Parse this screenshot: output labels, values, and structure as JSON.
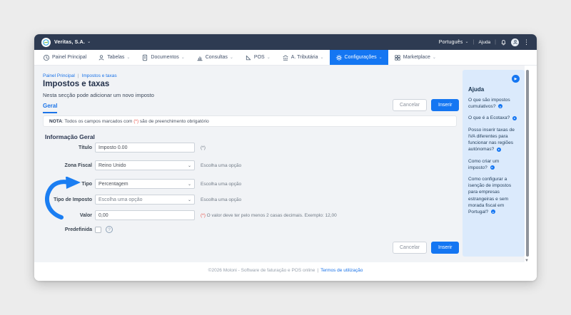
{
  "colors": {
    "accent_blue": "#1476f2",
    "topbar_navy": "#2e3b52",
    "help_panel_bg": "#dbeafc",
    "required_red": "#e8584f",
    "content_bg": "#f1f3f6"
  },
  "topbar": {
    "company": "Veritas, S.A.",
    "language": "Português",
    "help_link": "Ajuda"
  },
  "nav": {
    "items": [
      {
        "label": "Painel Principal",
        "icon": "clock-icon",
        "active": false
      },
      {
        "label": "Tabelas",
        "icon": "person-icon",
        "active": false
      },
      {
        "label": "Documentos",
        "icon": "document-icon",
        "active": false
      },
      {
        "label": "Consultas",
        "icon": "bar-chart-icon",
        "active": false
      },
      {
        "label": "POS",
        "icon": "set-square-icon",
        "active": false
      },
      {
        "label": "A. Tributária",
        "icon": "bank-icon",
        "active": false
      },
      {
        "label": "Configurações",
        "icon": "gear-icon",
        "active": true
      },
      {
        "label": "Marketplace",
        "icon": "grid-icon",
        "active": false
      }
    ]
  },
  "breadcrumb": {
    "items": [
      "Painel Principal",
      "Impostos e taxas"
    ],
    "separator": "|"
  },
  "page": {
    "title": "Impostos e taxas",
    "subtitle": "Nesta secção pode adicionar um novo imposto",
    "section_title": "Informação Geral"
  },
  "tabs": [
    {
      "label": "Geral",
      "active": true
    }
  ],
  "actions": {
    "cancel": "Cancelar",
    "insert": "Inserir"
  },
  "note": {
    "label": "NOTA",
    "before_marker": ": Todos os campos marcados com ",
    "marker": "(*)",
    "after_marker": " são de preenchimento obrigatório"
  },
  "form": {
    "titulo": {
      "label": "Título",
      "value": "Imposto 0.00",
      "required": "(*)"
    },
    "zona_fiscal": {
      "label": "Zona Fiscal",
      "value": "Reino Unido",
      "helper": "Escolha uma opção"
    },
    "tipo": {
      "label": "Tipo",
      "value": "Percentagem",
      "helper": "Escolha uma opção"
    },
    "tipo_imposto": {
      "label": "Tipo de Imposto",
      "value": "Escolha uma opção",
      "helper": "Escolha uma opção"
    },
    "valor": {
      "label": "Valor",
      "value": "0,00",
      "required": "(*)",
      "helper": "O valor deve ter pelo menos 2 casas decimais. Exemplo: 12,00"
    },
    "predefinida": {
      "label": "Predefinida",
      "checked": false
    }
  },
  "help_panel": {
    "title": "Ajuda",
    "items": [
      "O que são impostos cumulativos?",
      "O que é a Ecotaxa?",
      "Posso inserir taxas de IVA diferentes para funcionar nas regiões autónomas?",
      "Como criar um imposto?",
      "Como configurar a isenção de impostos para empresas estrangeiras e sem morada fiscal em Portugal?"
    ]
  },
  "footer": {
    "copyright": "©2026 Moloni - Software de faturação e POS online",
    "separator": "|",
    "terms_link": "Termos de utilização"
  }
}
